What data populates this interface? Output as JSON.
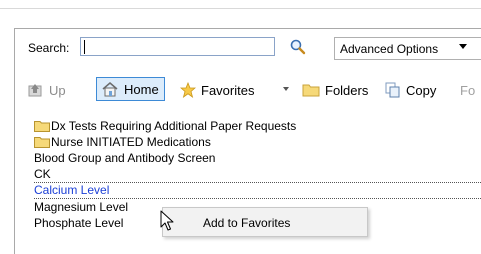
{
  "search": {
    "label": "Search:",
    "value": "",
    "placeholder": ""
  },
  "advanced": {
    "label": "Advanced Options"
  },
  "toolbar": {
    "up": "Up",
    "home": "Home",
    "favorites": "Favorites",
    "folders": "Folders",
    "copy": "Copy",
    "truncated": "Fo"
  },
  "list": {
    "items": [
      {
        "label": "Dx Tests Requiring Additional Paper Requests",
        "type": "folder"
      },
      {
        "label": "Nurse INITIATED Medications",
        "type": "folder"
      },
      {
        "label": "Blood Group and Antibody Screen",
        "type": "item"
      },
      {
        "label": "CK",
        "type": "item"
      },
      {
        "label": "Calcium Level",
        "type": "item",
        "selected": true
      },
      {
        "label": "Magnesium Level",
        "type": "item"
      },
      {
        "label": "Phosphate Level",
        "type": "item"
      }
    ]
  },
  "context_menu": {
    "items": [
      "Add to Favorites"
    ]
  },
  "colors": {
    "selected_text": "#1b3fd6",
    "home_highlight": "#dcecfb",
    "home_border": "#3d8ad6"
  },
  "icons": [
    "search-icon",
    "up-arrow-icon",
    "home-icon",
    "star-icon",
    "folder-icon",
    "copy-icon",
    "mouse-pointer-icon"
  ]
}
